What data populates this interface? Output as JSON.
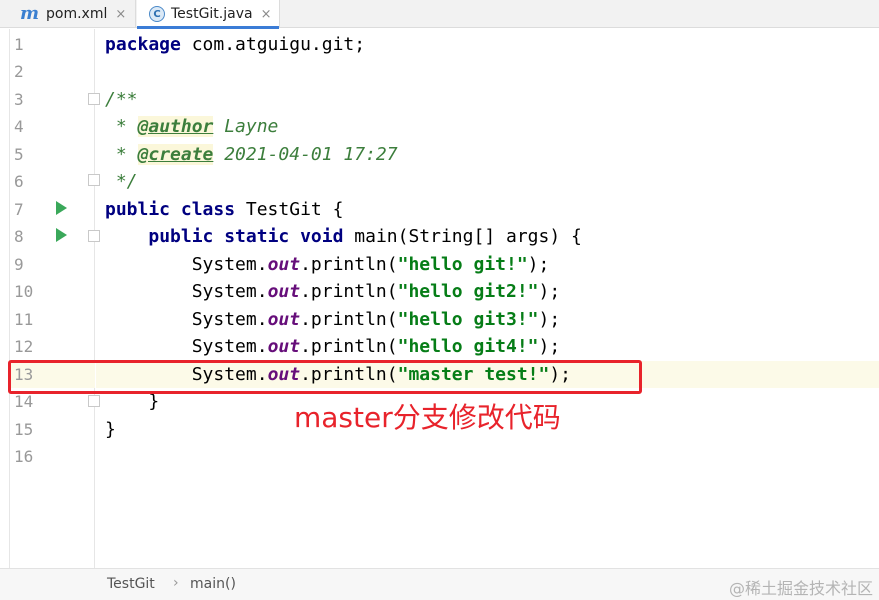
{
  "tabs": [
    {
      "label": "pom.xml",
      "icon": "maven-m-icon",
      "close": "×"
    },
    {
      "label": "TestGit.java",
      "icon": "java-class-icon",
      "icon_letter": "C",
      "close": "×",
      "active": true
    }
  ],
  "line_numbers": [
    "1",
    "2",
    "3",
    "4",
    "5",
    "6",
    "7",
    "8",
    "9",
    "10",
    "11",
    "12",
    "13",
    "14",
    "15",
    "16"
  ],
  "code": {
    "l1_kw": "package",
    "l1_rest": " com.atguigu.git;",
    "l3": "/**",
    "l4_pre": " * ",
    "l4_tag": "@author",
    "l4_rest": " Layne",
    "l5_pre": " * ",
    "l5_tag": "@create",
    "l5_rest": " 2021-04-01 17:27",
    "l6": " */",
    "l7_kw": "public class",
    "l7_rest": " TestGit {",
    "l8_indent": "    ",
    "l8_kw": "public static void",
    "l8_rest": " main(String[] args) {",
    "sys_prefix": "        System.",
    "out": "out",
    "println_open": ".println(",
    "close": ");",
    "l9_str": "\"hello git!\"",
    "l10_str": "\"hello git2!\"",
    "l11_str": "\"hello git3!\"",
    "l12_str": "\"hello git4!\"",
    "l13_str": "\"master test!\"",
    "l14": "    }",
    "l15": "}"
  },
  "annotation": "master分支修改代码",
  "breadcrumb": {
    "class": "TestGit",
    "separator": "›",
    "method": "main()"
  },
  "watermark": "@稀土掘金技术社区",
  "colors": {
    "accent": "#3b7cd6",
    "highlight": "#e8232b",
    "keyword": "#000080",
    "string": "#067d17",
    "comment": "#3c7e3c"
  }
}
